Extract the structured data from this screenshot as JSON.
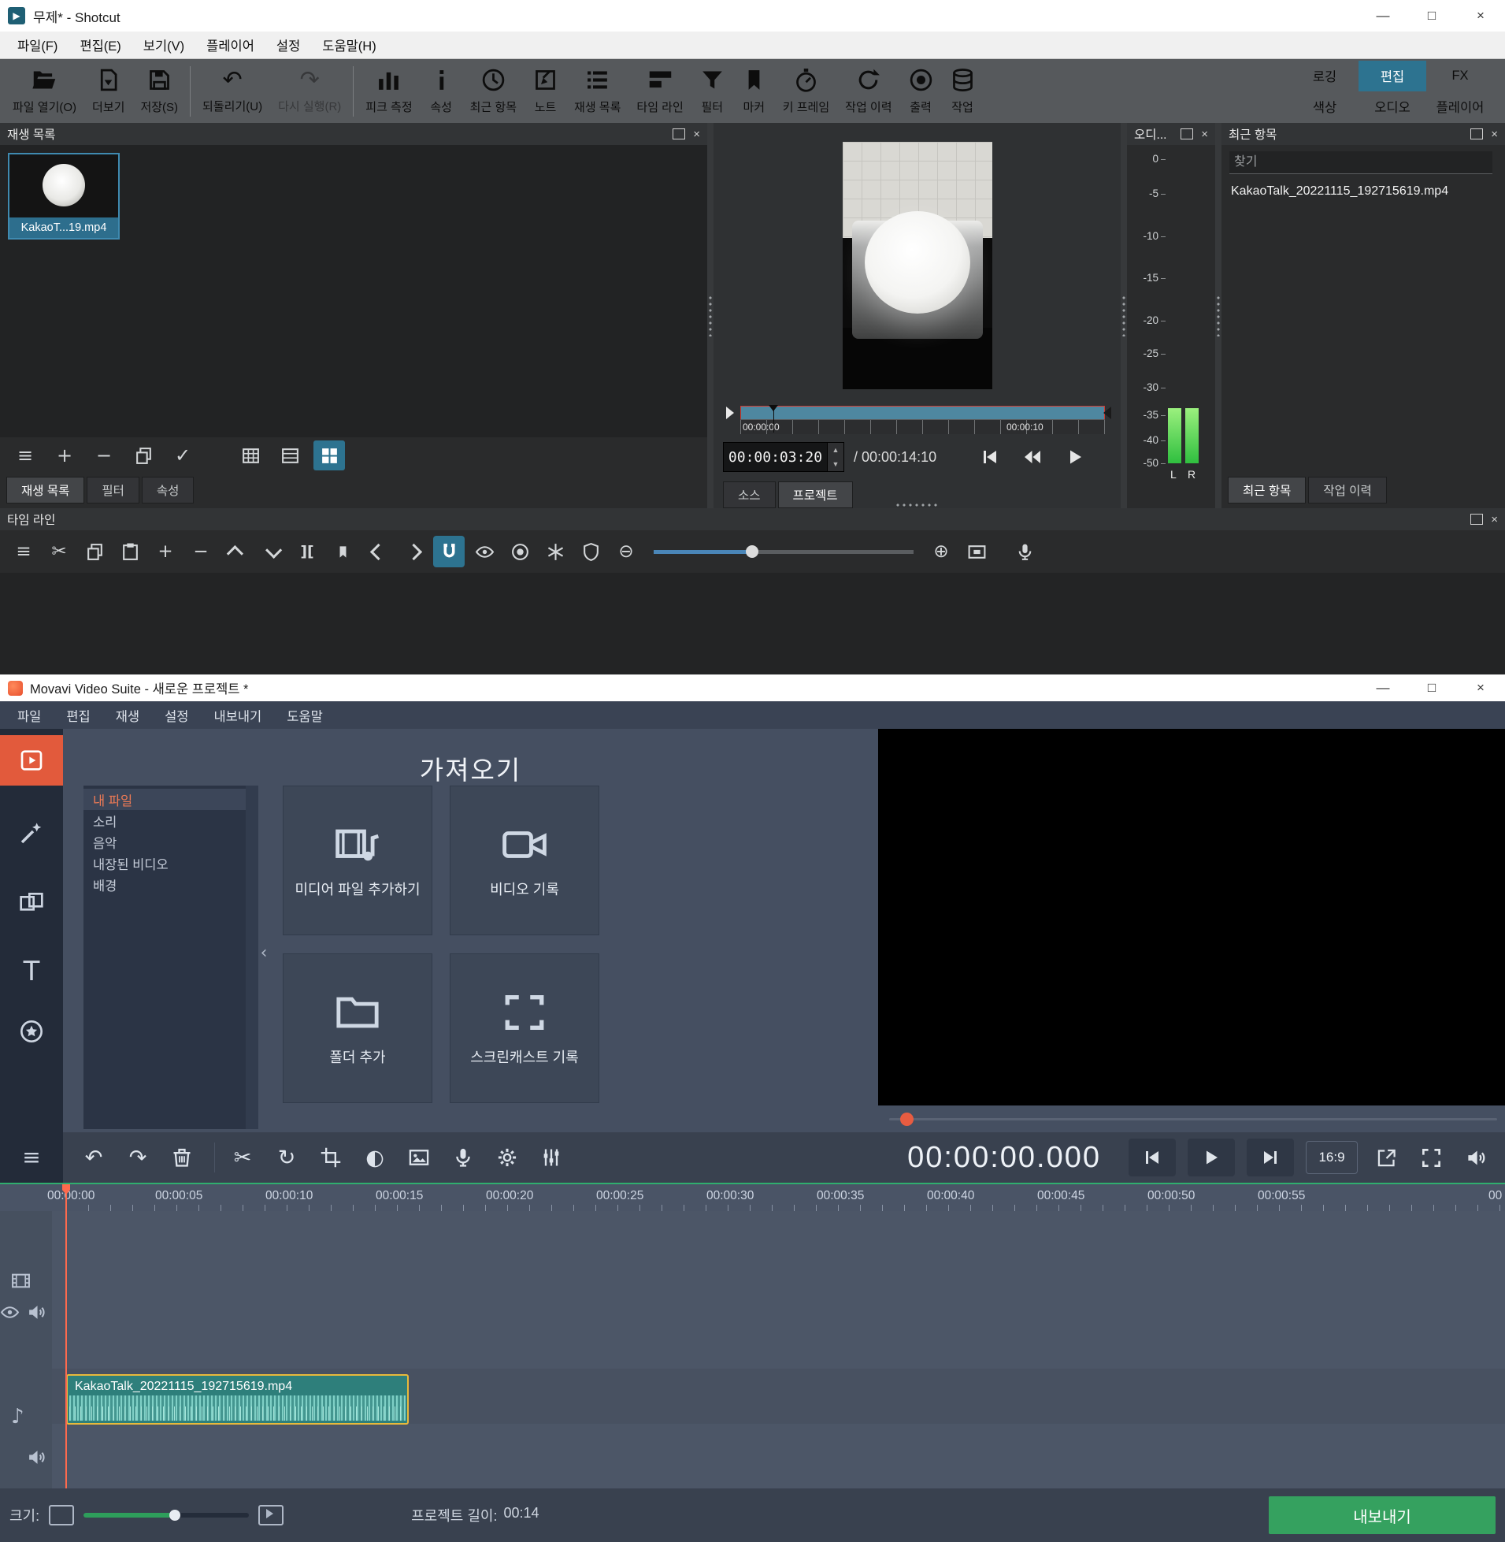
{
  "shotcut": {
    "titlebar": {
      "title": "무제* - Shotcut",
      "minimize": "—",
      "maximize": "□",
      "close": "×"
    },
    "menu": [
      "파일(F)",
      "편집(E)",
      "보기(V)",
      "플레이어",
      "설정",
      "도움말(H)"
    ],
    "toolbar": {
      "buttons": [
        "파일 열기(O)",
        "더보기",
        "저장(S)",
        "되돌리기(U)",
        "다시 실행(R)",
        "피크 측정",
        "속성",
        "최근 항목",
        "노트",
        "재생 목록",
        "타임 라인",
        "필터",
        "마커",
        "키 프레임",
        "작업 이력",
        "출력",
        "작업"
      ],
      "layouts": [
        "로깅",
        "편집",
        "FX",
        "색상",
        "오디오",
        "플레이어"
      ],
      "active_layout": "편집"
    },
    "playlist": {
      "header": "재생 목록",
      "clip_label": "KakaoT...19.mp4",
      "tabs": [
        "재생 목록",
        "필터",
        "속성"
      ]
    },
    "preview": {
      "ruler_start": "00:00:00",
      "ruler_mark": "00:00:10",
      "current_time": "00:00:03:20",
      "total_time": "/ 00:00:14:10",
      "tabs": [
        "소스",
        "프로젝트"
      ],
      "active_tab": "프로젝트"
    },
    "audio_meter": {
      "header": "오디...",
      "ticks": [
        "0",
        "-5",
        "-10",
        "-15",
        "-20",
        "-25",
        "-30",
        "-35",
        "-40",
        "-50"
      ],
      "channels": [
        "L",
        "R"
      ]
    },
    "recent": {
      "header": "최근 항목",
      "search_placeholder": "찾기",
      "file": "KakaoTalk_20221115_192715619.mp4",
      "tabs": [
        "최근 항목",
        "작업 이력"
      ]
    },
    "timeline": {
      "header": "타임 라인"
    }
  },
  "movavi": {
    "titlebar": {
      "title": "Movavi Video Suite - 새로운 프로젝트 *",
      "minimize": "—",
      "maximize": "□",
      "close": "×"
    },
    "menu": [
      "파일",
      "편집",
      "재생",
      "설정",
      "내보내기",
      "도움말"
    ],
    "import": {
      "title": "가져오기",
      "categories": [
        "내 파일",
        "소리",
        "음악",
        "내장된 비디오",
        "배경"
      ],
      "active_category": "내 파일",
      "cards": [
        "미디어 파일 추가하기",
        "비디오 기록",
        "폴더 추가",
        "스크린캐스트 기록"
      ]
    },
    "player": {
      "timecode": "00:00:00.000",
      "aspect_ratio": "16:9"
    },
    "timeline": {
      "ruler": [
        "00:00:00",
        "00:00:05",
        "00:00:10",
        "00:00:15",
        "00:00:20",
        "00:00:25",
        "00:00:30",
        "00:00:35",
        "00:00:40",
        "00:00:45",
        "00:00:50",
        "00:00:55",
        "00"
      ],
      "clip": "KakaoTalk_20221115_192715619.mp4"
    },
    "footer": {
      "size_label": "크기:",
      "length_label": "프로젝트 길이:",
      "length_value": "00:14",
      "export": "내보내기"
    }
  }
}
